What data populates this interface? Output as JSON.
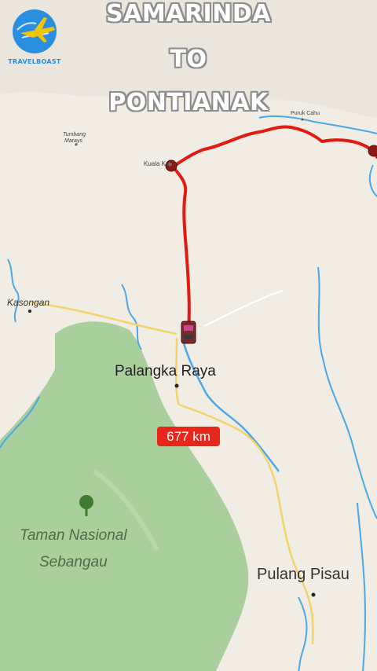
{
  "title": {
    "line1": "SAMARINDA",
    "line2": "TO",
    "line3": "PONTIANAK"
  },
  "logo": {
    "text": "TRAVELBOAST",
    "icon": "airplane-globe-icon",
    "color": "#2a8fe0"
  },
  "distance": {
    "label": "677 km",
    "color": "#e8261b"
  },
  "places": {
    "palangka_raya": "Palangka Raya",
    "kasongan": "Kasongan",
    "kuala_kurun": "Kuala Kurun",
    "puruk_cahu": "Puruk Cahu",
    "tumbang_marays_1": "Tumbang",
    "tumbang_marays_2": "Marays",
    "pulang_pisau": "Pulang Pisau",
    "taman_1": "Taman Nasional",
    "taman_2": "Sebangau"
  },
  "colors": {
    "route": "#e11a12",
    "park": "#a9cf9c",
    "river": "#4aa8e8",
    "road": "#f3d36b",
    "land": "#f1ece4"
  }
}
